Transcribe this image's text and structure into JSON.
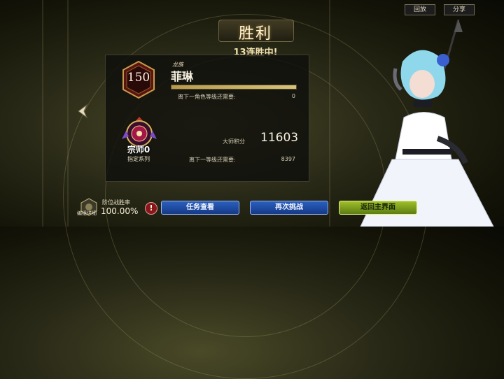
{
  "top_buttons": {
    "replay": "回放",
    "share": "分享"
  },
  "result": {
    "title": "胜利",
    "streak": "13连胜中!"
  },
  "character": {
    "level": "150",
    "race": "龙族",
    "name": "菲琳",
    "xp_progress": 1.0,
    "next_level_label": "离下一角色等级还需要:",
    "next_level_value": "0"
  },
  "rank": {
    "label": "宗师0",
    "series": "指定系列",
    "master_points_label": "大师积分",
    "master_points_value": "11603",
    "next_rank_label": "离下一等级还需要:",
    "next_rank_value": "8397"
  },
  "win_rate": {
    "title": "阶位战胜率",
    "value": "100.00%",
    "deck_detail": "编组详细"
  },
  "actions": {
    "mission": "任务查看",
    "retry": "再次挑战",
    "home": "返回主界面"
  },
  "colors": {
    "accent_gold": "#d8c27a",
    "button_blue": "#2a5fbf",
    "button_green": "#9fbf2a"
  }
}
